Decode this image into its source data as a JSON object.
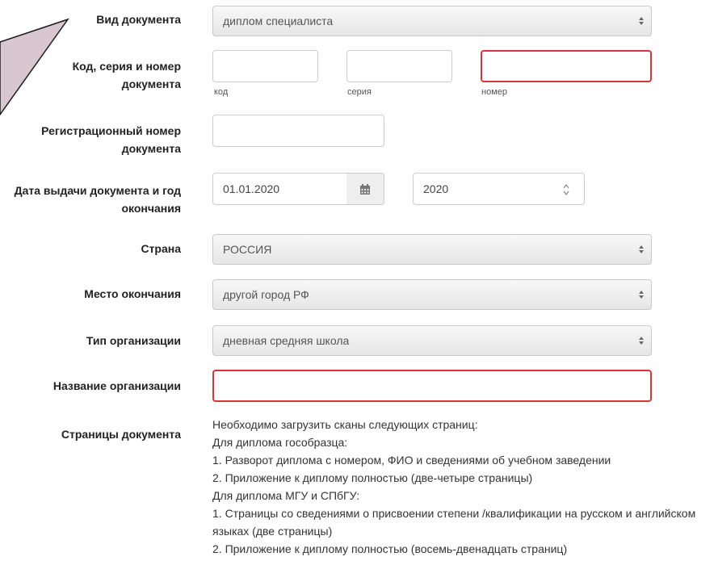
{
  "form": {
    "doc_type": {
      "label": "Вид документа",
      "value": "диплом специалиста"
    },
    "doc_code": {
      "label": "Код, серия и номер документа",
      "code_value": "",
      "series_value": "",
      "number_value": "",
      "code_hint": "код",
      "series_hint": "серия",
      "number_hint": "номер"
    },
    "reg_number": {
      "label": "Регистрационный номер документа",
      "value": ""
    },
    "issue": {
      "label": "Дата выдачи документа и год окончания",
      "date_value": "01.01.2020",
      "year_value": "2020"
    },
    "country": {
      "label": "Страна",
      "value": "РОССИЯ"
    },
    "place": {
      "label": "Место окончания",
      "value": "другой город РФ"
    },
    "org_type": {
      "label": "Тип организации",
      "value": "дневная средняя школа"
    },
    "org_name": {
      "label": "Название организации",
      "value": ""
    },
    "pages": {
      "label": "Страницы документа",
      "lines": [
        "Необходимо загрузить сканы следующих страниц:",
        "Для диплома гособразца:",
        "1. Разворот диплома с номером, ФИО и сведениями об учебном заведении",
        "2. Приложение к диплому полностью (две-четыре страницы)",
        "Для диплома МГУ и СПбГУ:",
        "1. Страницы со сведениями о присвоении степени /квалификации на русском и английском языках (две страницы)",
        "2. Приложение к диплому полностью (восемь-двенадцать страниц)"
      ]
    }
  },
  "colors": {
    "error_border": "#d9343a",
    "callout_fill": "#d9c7cf",
    "callout_stroke": "#1a1a1a"
  },
  "icons": {
    "calendar": "calendar-icon",
    "select_arrows": "updown-arrows-icon",
    "spinner": "spinner-arrows-icon"
  }
}
